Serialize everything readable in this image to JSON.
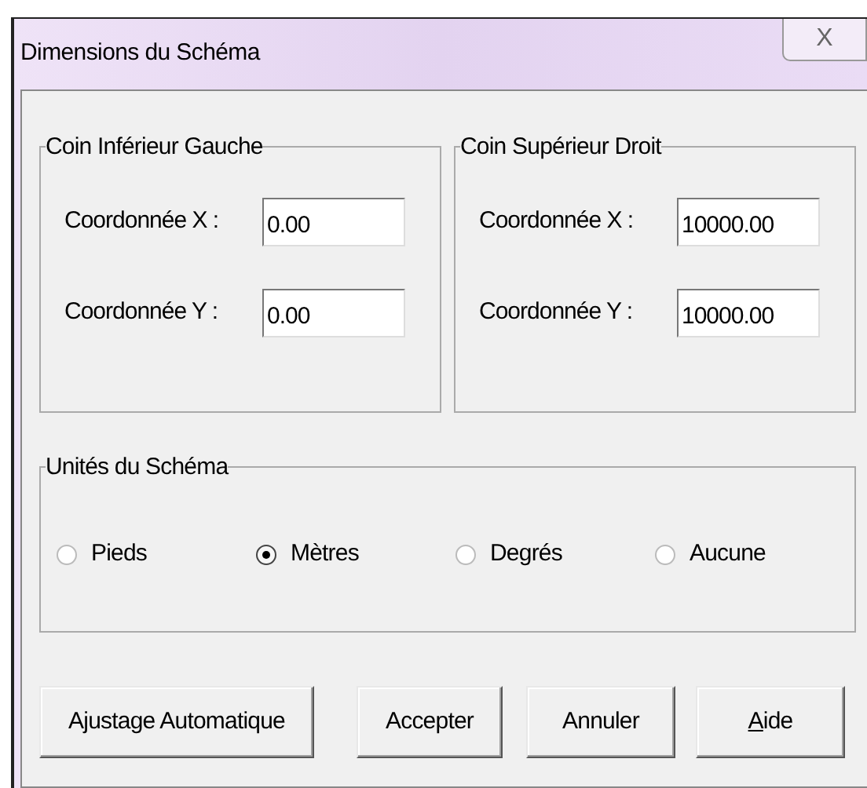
{
  "window": {
    "title": "Dimensions du Schéma",
    "close": "X"
  },
  "groups": [
    {
      "title": "Coin Inférieur Gauche",
      "fields": [
        {
          "label": "Coordonnée X :",
          "value": "0.00"
        },
        {
          "label": "Coordonnée Y :",
          "value": "0.00"
        }
      ]
    },
    {
      "title": "Coin Supérieur Droit",
      "fields": [
        {
          "label": "Coordonnée X :",
          "value": "10000.00"
        },
        {
          "label": "Coordonnée Y :",
          "value": "10000.00"
        }
      ]
    }
  ],
  "units": {
    "title": "Unités du Schéma",
    "options": [
      {
        "label": "Pieds",
        "selected": false
      },
      {
        "label": "Mètres",
        "selected": true
      },
      {
        "label": "Degrés",
        "selected": false
      },
      {
        "label": "Aucune",
        "selected": false
      }
    ]
  },
  "buttons": [
    {
      "label": "Ajustage Automatique",
      "underline_first": false
    },
    {
      "label": "Accepter",
      "underline_first": false
    },
    {
      "label": "Annuler",
      "underline_first": false
    },
    {
      "label": "Aide",
      "underline_first": true
    }
  ]
}
